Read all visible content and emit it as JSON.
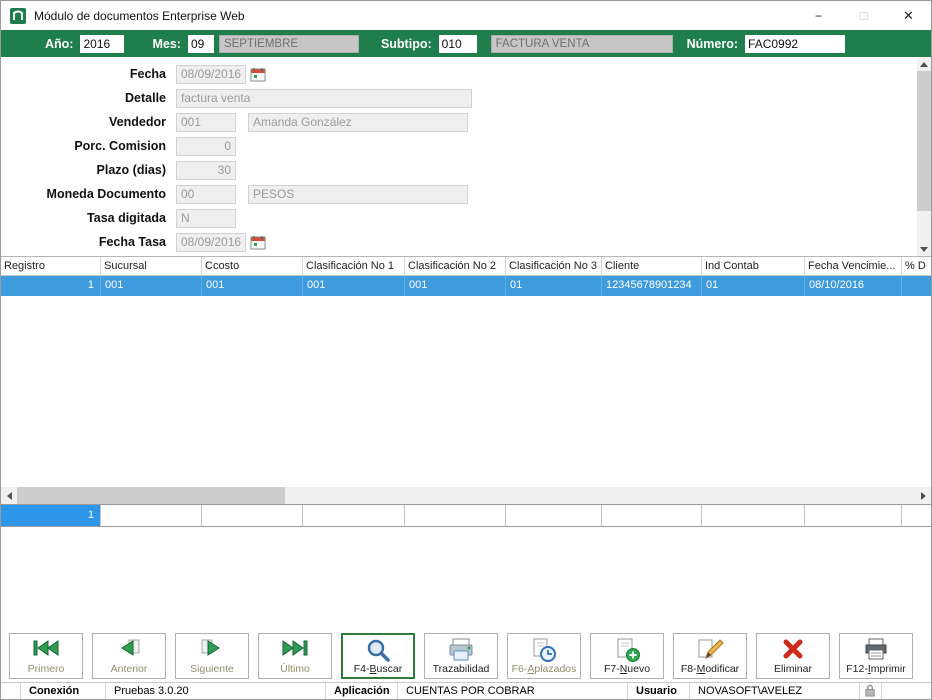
{
  "window": {
    "title": "Módulo de documentos Enterprise Web",
    "minimize": "−",
    "maximize": "□",
    "close": "✕"
  },
  "header": {
    "ano_label": "Año:",
    "ano_value": "2016",
    "mes_label": "Mes:",
    "mes_value": "09",
    "mes_name": "SEPTIEMBRE",
    "subtipo_label": "Subtipo:",
    "subtipo_value": "010",
    "subtipo_name": "FACTURA VENTA",
    "numero_label": "Número:",
    "numero_value": "FAC0992"
  },
  "form": {
    "fecha_label": "Fecha",
    "fecha_value": "08/09/2016",
    "detalle_label": "Detalle",
    "detalle_value": "factura venta",
    "vendedor_label": "Vendedor",
    "vendedor_code": "001",
    "vendedor_name": "Amanda González",
    "porc_label": "Porc. Comision",
    "porc_value": "0",
    "plazo_label": "Plazo (dias)",
    "plazo_value": "30",
    "moneda_label": "Moneda Documento",
    "moneda_code": "00",
    "moneda_name": "PESOS",
    "tasa_label": "Tasa digitada",
    "tasa_value": "N",
    "fecha_tasa_label": "Fecha Tasa",
    "fecha_tasa_value": "08/09/2016"
  },
  "grid": {
    "columns": [
      "Registro",
      "Sucursal",
      "Ccosto",
      "Clasificación No 1",
      "Clasificación No 2",
      "Clasificación No 3",
      "Cliente",
      "Ind Contab",
      "Fecha Vencimie...",
      "% D"
    ],
    "row": [
      "1",
      "001",
      "001",
      "001",
      "001",
      "01",
      "12345678901234",
      "01",
      "08/10/2016",
      ""
    ],
    "summary_value": "1"
  },
  "toolbar": {
    "buttons": [
      {
        "icon": "first-icon",
        "pre": "Primero",
        "key": "",
        "post": ""
      },
      {
        "icon": "previous-icon",
        "pre": "Anterior",
        "key": "",
        "post": ""
      },
      {
        "icon": "next-icon",
        "pre": "Siguiente",
        "key": "",
        "post": ""
      },
      {
        "icon": "last-icon",
        "pre": "Último",
        "key": "",
        "post": ""
      },
      {
        "icon": "search-icon",
        "pre": "F4-",
        "key": "B",
        "post": "uscar"
      },
      {
        "icon": "traceability-icon",
        "pre": "Trazabilidad",
        "key": "",
        "post": ""
      },
      {
        "icon": "deferred-icon",
        "pre": "F6-",
        "key": "A",
        "post": "plazados"
      },
      {
        "icon": "new-icon",
        "pre": "F7-",
        "key": "N",
        "post": "uevo"
      },
      {
        "icon": "edit-icon",
        "pre": "F8-",
        "key": "M",
        "post": "odificar"
      },
      {
        "icon": "delete-icon",
        "pre": "Eliminar",
        "key": "",
        "post": ""
      },
      {
        "icon": "print-icon",
        "pre": "F12-",
        "key": "I",
        "post": "mprimir"
      }
    ]
  },
  "statusbar": {
    "conexion_label": "Conexión",
    "conexion_value": "Pruebas 3.0.20",
    "aplicacion_label": "Aplicación",
    "aplicacion_value": "CUENTAS POR COBRAR",
    "usuario_label": "Usuario",
    "usuario_value": "NOVASOFT\\AVELEZ"
  },
  "colors": {
    "header_green": "#1e7e4c",
    "selection_blue": "#3e9bdd",
    "summary_blue": "#2e96e8",
    "delete_red": "#cf2a1b"
  }
}
